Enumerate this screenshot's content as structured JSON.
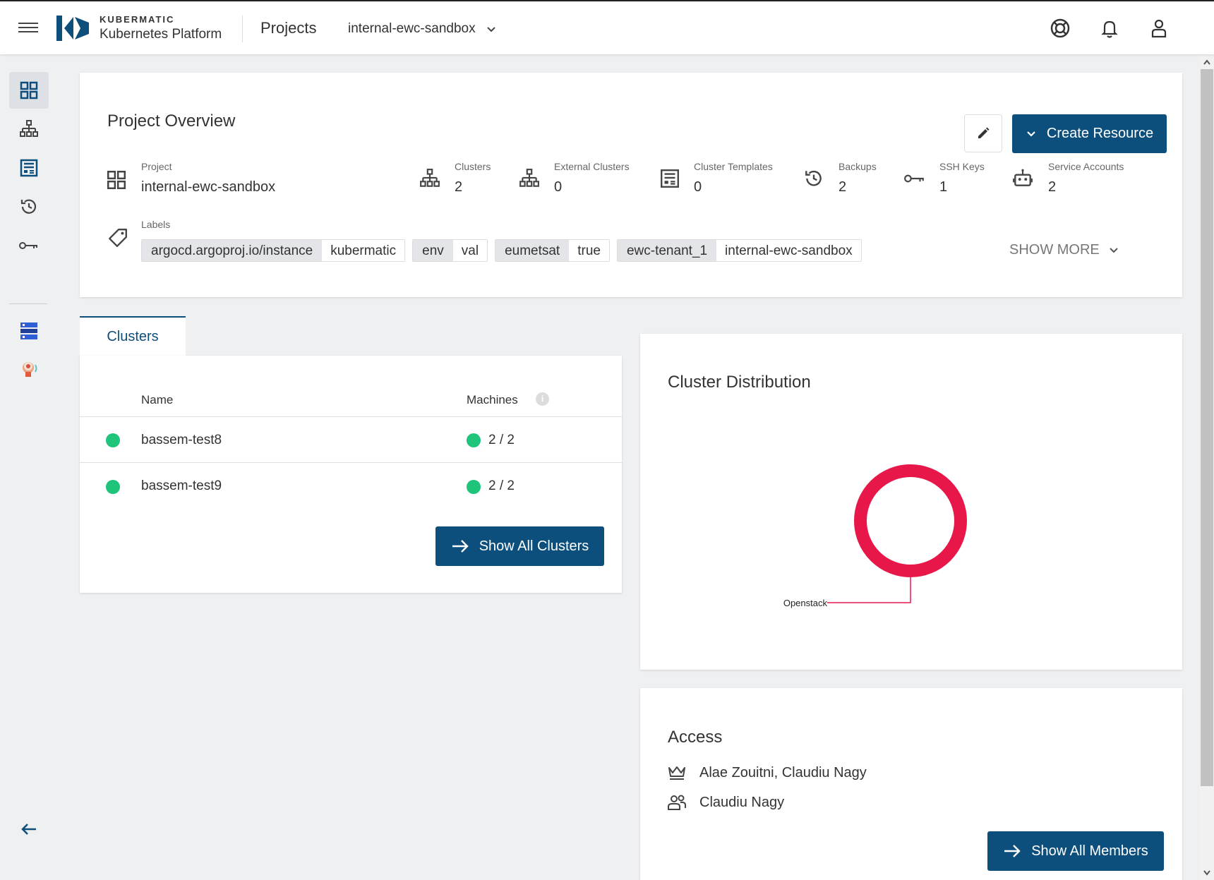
{
  "header": {
    "brand_top": "KUBERMATIC",
    "brand_bottom": "Kubernetes Platform",
    "nav_projects": "Projects",
    "project_select": "internal-ewc-sandbox"
  },
  "overview": {
    "title": "Project Overview",
    "create_label": "Create Resource",
    "project_label": "Project",
    "project_value": "internal-ewc-sandbox",
    "stats": [
      {
        "label": "Clusters",
        "value": "2",
        "icon": "sitemap-icon"
      },
      {
        "label": "External Clusters",
        "value": "0",
        "icon": "sitemap-icon"
      },
      {
        "label": "Cluster Templates",
        "value": "0",
        "icon": "template-icon"
      },
      {
        "label": "Backups",
        "value": "2",
        "icon": "history-icon"
      },
      {
        "label": "SSH Keys",
        "value": "1",
        "icon": "key-icon"
      },
      {
        "label": "Service Accounts",
        "value": "2",
        "icon": "robot-icon"
      }
    ],
    "labels_label": "Labels",
    "labels": [
      {
        "key": "argocd.argoproj.io/instance",
        "value": "kubermatic"
      },
      {
        "key": "env",
        "value": "val"
      },
      {
        "key": "eumetsat",
        "value": "true"
      },
      {
        "key": "ewc-tenant_1",
        "value": "internal-ewc-sandbox"
      }
    ],
    "show_more": "SHOW MORE"
  },
  "clusters": {
    "tab": "Clusters",
    "col_name": "Name",
    "col_machines": "Machines",
    "rows": [
      {
        "name": "bassem-test8",
        "machines": "2 / 2",
        "status_color": "#1ec47a"
      },
      {
        "name": "bassem-test9",
        "machines": "2 / 2",
        "status_color": "#1ec47a"
      }
    ],
    "show_all": "Show All Clusters"
  },
  "distribution": {
    "title": "Cluster Distribution",
    "chart_data": {
      "type": "pie",
      "categories": [
        "Openstack"
      ],
      "values": [
        2
      ],
      "colors": [
        "#e8174a"
      ]
    }
  },
  "access": {
    "title": "Access",
    "owners": "Alae Zouitni, Claudiu Nagy",
    "members": "Claudiu Nagy",
    "show_all": "Show All Members"
  },
  "colors": {
    "primary": "#0d4f7c",
    "status_ok": "#1ec47a",
    "chart": "#e8174a"
  }
}
